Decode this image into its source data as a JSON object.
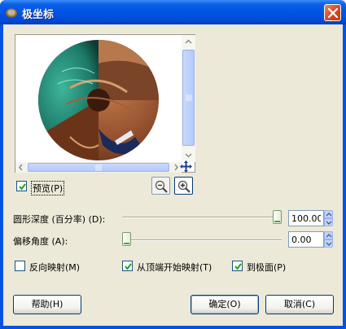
{
  "window": {
    "title": "极坐标"
  },
  "preview": {
    "checkbox_label": "预览(P)",
    "checked": true
  },
  "depth": {
    "label": "圆形深度 (百分率) (D):",
    "value": "100.00",
    "level_percent": 100
  },
  "offset": {
    "label": "偏移角度 (A):",
    "value": "0.00",
    "level_percent": 0
  },
  "options": [
    {
      "label": "反向映射(M)",
      "checked": false
    },
    {
      "label": "从顶端开始映射(T)",
      "checked": true
    },
    {
      "label": "到极面(P)",
      "checked": true
    }
  ],
  "buttons": {
    "help": "帮助(H)",
    "ok": "确定(O)",
    "cancel": "取消(C)"
  },
  "colors": {
    "title_bar": "#0054e3",
    "dialog_bg": "#ece9d8",
    "close_button": "#d94a25",
    "button_border": "#003c74"
  }
}
